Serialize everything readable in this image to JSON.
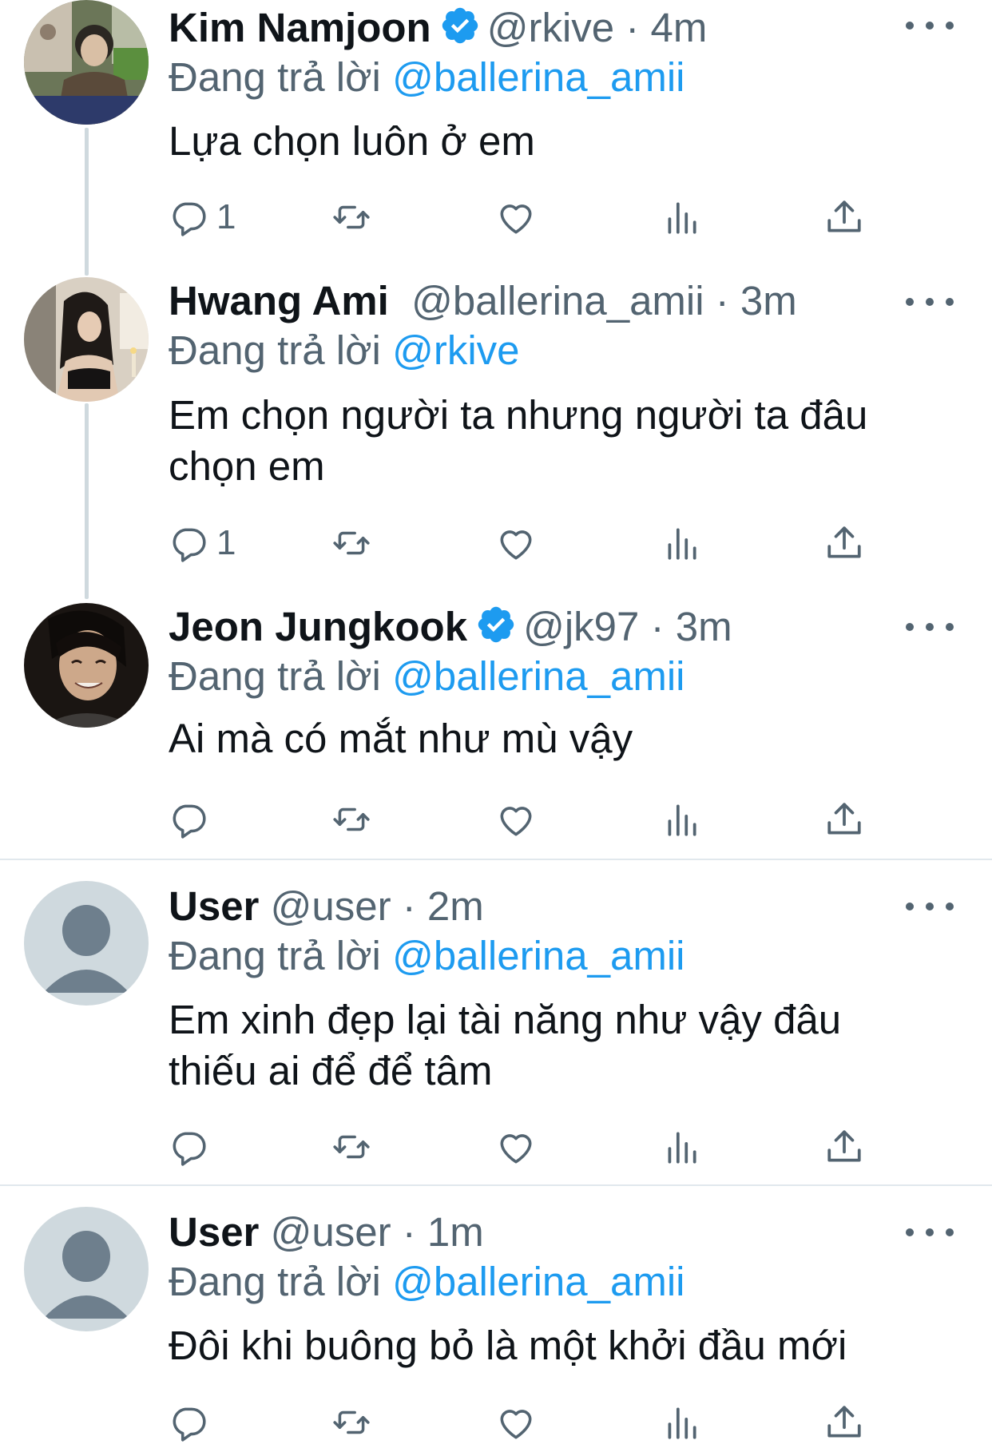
{
  "colors": {
    "accent": "#1d9bf0",
    "secondary_text": "#536471",
    "divider": "#e1e8ed"
  },
  "icons": {
    "reply": "reply-icon",
    "retweet": "retweet-icon",
    "like": "heart-icon",
    "views": "views-icon",
    "share": "share-icon",
    "more": "more-icon",
    "verified": "verified-icon"
  },
  "tweets": [
    {
      "name": "Kim Namjoon",
      "verified": true,
      "handle": "@rkive",
      "time": "4m",
      "replying_label": "Đang trả lời",
      "replying_to": "@ballerina_amii",
      "text": "Lựa chọn luôn ở em",
      "reply_count": "1"
    },
    {
      "name": "Hwang Ami",
      "verified": false,
      "handle": "@ballerina_amii",
      "time": "3m",
      "replying_label": "Đang trả lời",
      "replying_to": "@rkive",
      "text": "Em chọn người ta nhưng người ta đâu chọn em",
      "reply_count": "1"
    },
    {
      "name": "Jeon Jungkook",
      "verified": true,
      "handle": "@jk97",
      "time": "3m",
      "replying_label": "Đang trả lời",
      "replying_to": "@ballerina_amii",
      "text": "Ai mà có mắt như mù vậy",
      "reply_count": ""
    },
    {
      "name": "User",
      "verified": false,
      "handle": "@user",
      "time": "2m",
      "replying_label": "Đang trả lời",
      "replying_to": "@ballerina_amii",
      "text": "Em xinh đẹp lại tài năng như vậy đâu thiếu ai để để tâm",
      "reply_count": ""
    },
    {
      "name": "User",
      "verified": false,
      "handle": "@user",
      "time": "1m",
      "replying_label": "Đang trả lời",
      "replying_to": "@ballerina_amii",
      "text": "Đôi khi buông bỏ là một khởi đầu mới",
      "reply_count": ""
    }
  ]
}
